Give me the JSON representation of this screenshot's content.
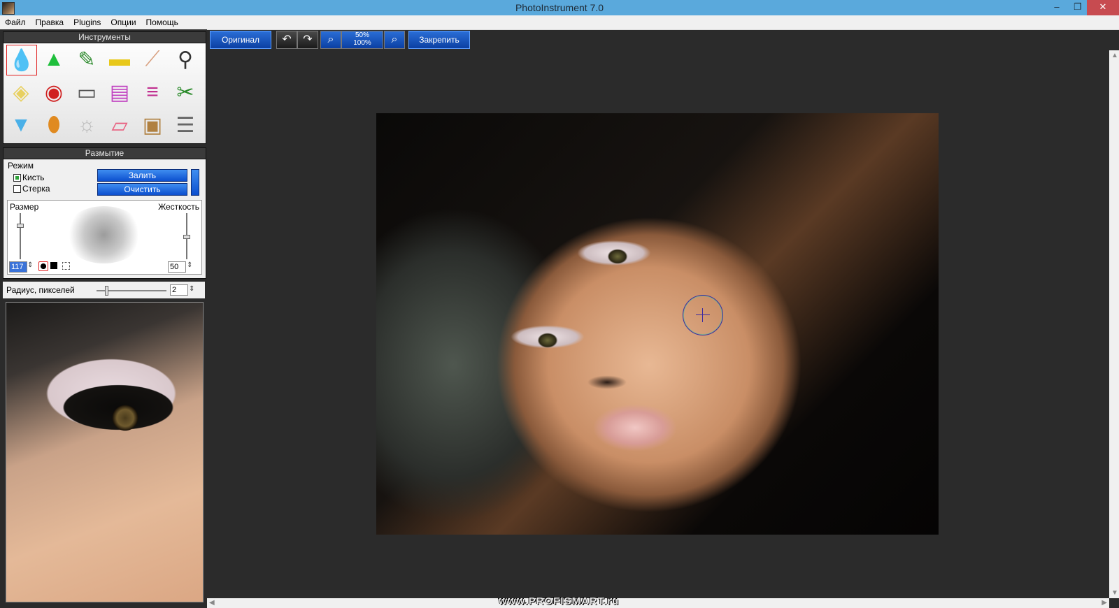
{
  "window": {
    "title": "PhotoInstrument 7.0"
  },
  "menu": [
    "Файл",
    "Правка",
    "Plugins",
    "Опции",
    "Помощь"
  ],
  "tools_panel": {
    "title": "Инструменты",
    "tools": [
      {
        "name": "blur-drop-icon",
        "glyph": "💧",
        "selected": true
      },
      {
        "name": "sharpen-cone-icon",
        "glyph": "▲"
      },
      {
        "name": "brushes-icon",
        "glyph": "✎"
      },
      {
        "name": "stamp-icon",
        "glyph": "▬"
      },
      {
        "name": "finger-smudge-icon",
        "glyph": "⟋"
      },
      {
        "name": "pin-icon",
        "glyph": "⚲"
      },
      {
        "name": "diamond-icon",
        "glyph": "◈"
      },
      {
        "name": "red-eye-icon",
        "glyph": "◉"
      },
      {
        "name": "gradient-bw-icon",
        "glyph": "▭"
      },
      {
        "name": "rainbow-icon",
        "glyph": "▤"
      },
      {
        "name": "color-lines-icon",
        "glyph": "≡"
      },
      {
        "name": "scissors-icon",
        "glyph": "✂"
      },
      {
        "name": "tube-icon",
        "glyph": "▼"
      },
      {
        "name": "bottle-icon",
        "glyph": "⬮"
      },
      {
        "name": "bulb-icon",
        "glyph": "☼"
      },
      {
        "name": "eraser-icon",
        "glyph": "▱"
      },
      {
        "name": "tv-icon",
        "glyph": "▣"
      },
      {
        "name": "text-layers-icon",
        "glyph": "☰"
      }
    ]
  },
  "blur_panel": {
    "title": "Размытие",
    "mode_label": "Режим",
    "brush_label": "Кисть",
    "eraser_label": "Стерка",
    "fill_button": "Залить",
    "clear_button": "Очистить",
    "size_label": "Размер",
    "hardness_label": "Жесткость",
    "size_value": "117",
    "hardness_value": "50",
    "radius_label": "Радиус, пикселей",
    "radius_value": "2"
  },
  "toolbar": {
    "original_button": "Оригинал",
    "zoom_50": "50%",
    "zoom_100": "100%",
    "fix_button": "Закрепить"
  },
  "watermark": "www.PROFISMART.ru"
}
